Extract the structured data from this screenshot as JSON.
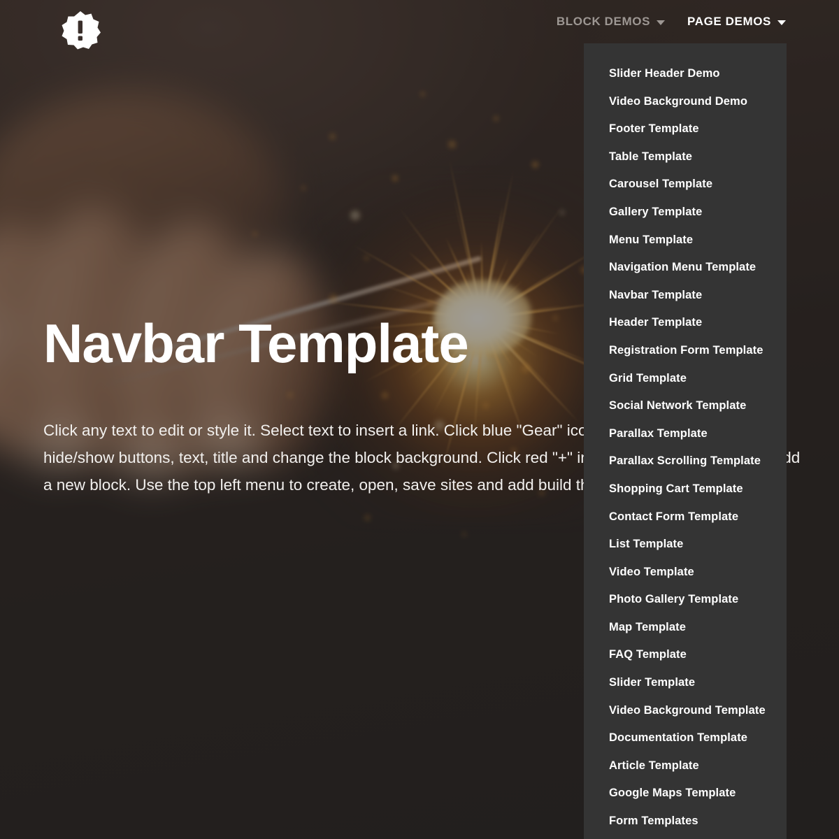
{
  "site": {
    "logo_icon": "badge-exclamation-icon",
    "logo_alt": "Mobirise badge logo"
  },
  "navbar": {
    "items": [
      {
        "label": "BLOCK DEMOS",
        "state": "inactive",
        "has_caret": true,
        "caret_icon": "chevron-down-icon"
      },
      {
        "label": "PAGE DEMOS",
        "state": "active",
        "has_caret": true,
        "caret_icon": "chevron-down-icon"
      }
    ]
  },
  "dropdown": {
    "open_for": "PAGE DEMOS",
    "background_color": "#343434",
    "items": [
      "Slider Header Demo",
      "Video Background Demo",
      "Footer Template",
      "Table Template",
      "Carousel Template",
      "Gallery Template",
      "Menu Template",
      "Navigation Menu Template",
      "Navbar Template",
      "Header Template",
      "Registration Form Template",
      "Grid Template",
      "Social Network Template",
      "Parallax Template",
      "Parallax Scrolling Template",
      "Shopping Cart Template",
      "Contact Form Template",
      "List Template",
      "Video Template",
      "Photo Gallery Template",
      "Map Template",
      "FAQ Template",
      "Slider Template",
      "Video Background Template",
      "Documentation Template",
      "Article Template",
      "Google Maps Template",
      "Form Templates"
    ]
  },
  "hero": {
    "title": "Navbar Template",
    "paragraph": "Click any text to edit or style it. Select text to insert a link. Click blue \"Gear\" icon in the upper right corner to hide/show buttons, text, title and change the block background. Click red \"+\" in the bottom right corner to add a new block. Use the top left menu to create, open, save sites and add build themes.",
    "title_color": "#ffffff",
    "text_color": "#f2f0ee",
    "background_description": "blurred photo of a hand holding a lit sparkler"
  }
}
